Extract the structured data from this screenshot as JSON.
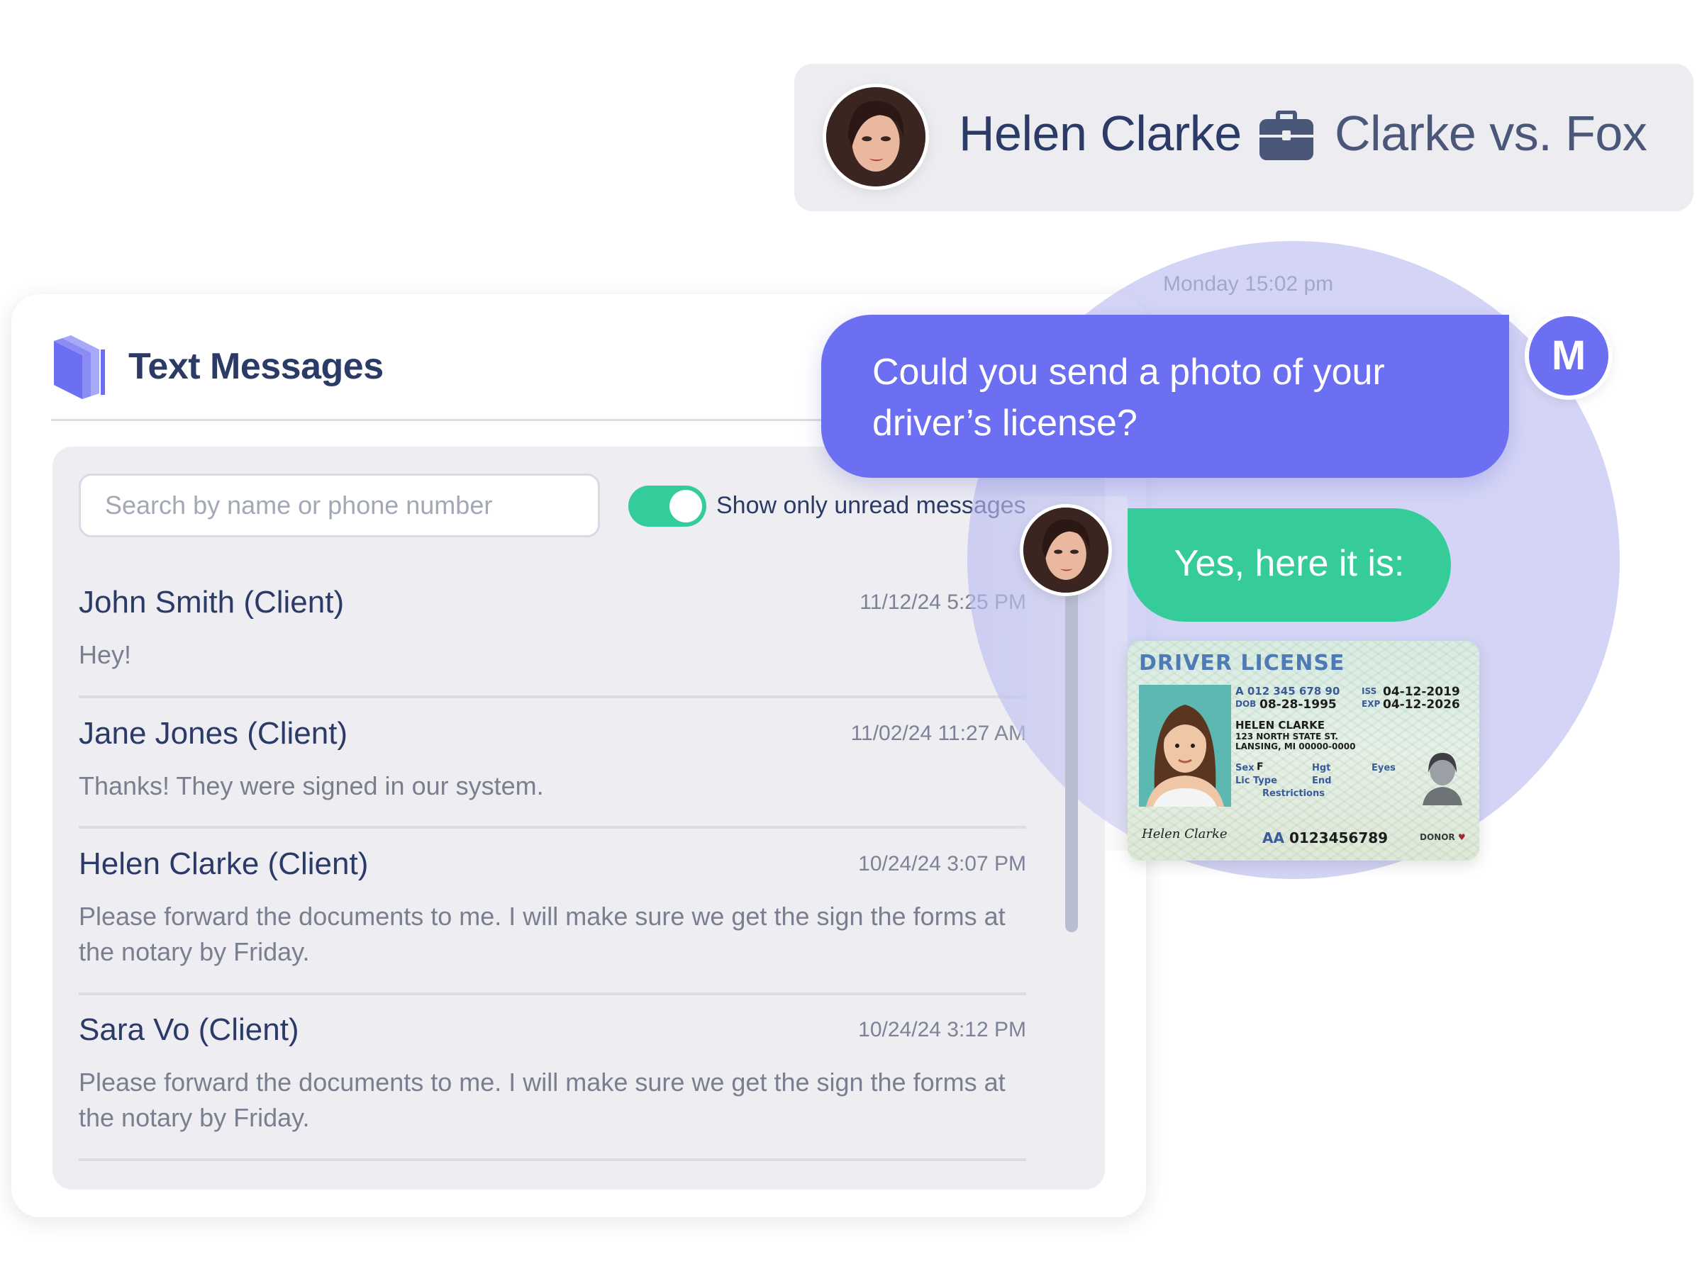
{
  "header": {
    "contact_name": "Helen Clarke",
    "case_name": "Clarke vs. Fox"
  },
  "card": {
    "title": "Text Messages",
    "search": {
      "placeholder": "Search by name or phone number",
      "value": ""
    },
    "toggle": {
      "label": "Show only unread messages",
      "on": true
    },
    "conversations": [
      {
        "name": "John Smith (Client)",
        "time": "11/12/24 5:25 PM",
        "message": "Hey!"
      },
      {
        "name": "Jane Jones (Client)",
        "time": "11/02/24 11:27 AM",
        "message": "Thanks! They were signed in our system."
      },
      {
        "name": "Helen Clarke (Client)",
        "time": "10/24/24 3:07 PM",
        "message": "Please forward the documents to me. I will make sure we get the sign the forms at the notary by Friday."
      },
      {
        "name": "Sara Vo (Client)",
        "time": "10/24/24 3:12 PM",
        "message": "Please forward the documents to me. I will make sure we get the sign the forms at the notary by Friday."
      }
    ]
  },
  "chat": {
    "timestamp": "Monday 15:02 pm",
    "outgoing": "Could you send a photo of your driver’s license?",
    "sender_initial": "M",
    "incoming": "Yes, here it is:"
  },
  "license": {
    "title": "DRIVER LICENSE",
    "id_line": "A 012 345 678 90",
    "dob_label": "DOB",
    "dob": "08-28-1995",
    "iss_label": "ISS",
    "iss": "04-12-2019",
    "exp_label": "EXP",
    "exp": "04-12-2026",
    "name": "HELEN CLARKE",
    "address_1": "123 NORTH STATE ST.",
    "address_2": "LANSING, MI 00000-0000",
    "sex_label": "Sex",
    "sex": "F",
    "hgt_label": "Hgt",
    "eyes_label": "Eyes",
    "lic_type_label": "Lic Type",
    "end_label": "End",
    "restrictions_label": "Restrictions",
    "signature": "Helen Clarke",
    "number_prefix": "AA",
    "number": "0123456789",
    "donor_label": "DONOR"
  },
  "colors": {
    "accent_purple": "#6d6ff2",
    "accent_green": "#36cc9a",
    "text_navy": "#2b3a67"
  },
  "icons": [
    "briefcase-icon",
    "book-logo-icon",
    "toggle-switch"
  ]
}
